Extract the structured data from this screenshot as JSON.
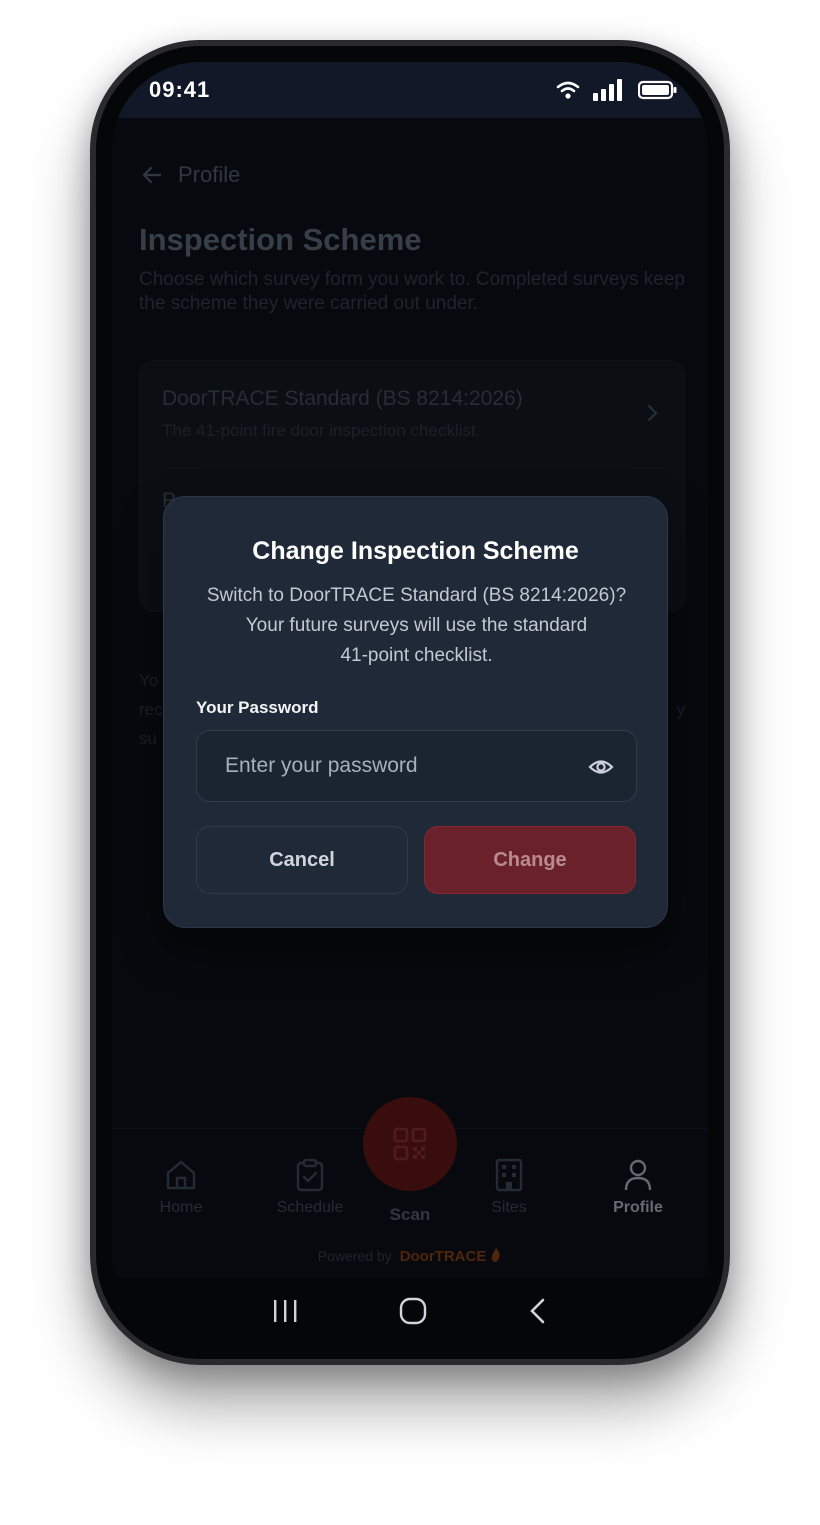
{
  "status_bar": {
    "time": "09:41"
  },
  "header": {
    "back_label": "Profile"
  },
  "page": {
    "title": "Inspection Scheme",
    "description": "Choose which survey form you work to. Completed surveys keep the scheme they were carried out under."
  },
  "schemes": [
    {
      "name": "DoorTRACE Standard (BS 8214:2026)",
      "subtitle": "The 41-point fire door inspection checklist."
    },
    {
      "name": "P"
    }
  ],
  "footnote": {
    "line1": "Yo",
    "line2_start": "rec",
    "line2_end": "y",
    "line3": "su"
  },
  "modal": {
    "title": "Change Inspection Scheme",
    "message_line1": "Switch to DoorTRACE Standard (BS 8214:2026)?",
    "message_line2": "Your future surveys will use the standard",
    "message_line3": "41-point checklist.",
    "password_label": "Your Password",
    "password_placeholder": "Enter your password",
    "cancel_label": "Cancel",
    "change_label": "Change"
  },
  "bottom_nav": {
    "items": [
      {
        "label": "Home"
      },
      {
        "label": "Schedule"
      },
      {
        "label": "Scan"
      },
      {
        "label": "Sites"
      },
      {
        "label": "Profile"
      }
    ],
    "active": "Profile",
    "powered_by": "Powered by",
    "brand": "DoorTRACE"
  },
  "colors": {
    "accent_red": "#7f1d1d",
    "modal_bg": "#1f2937",
    "screen_bg": "#0b0f16"
  }
}
